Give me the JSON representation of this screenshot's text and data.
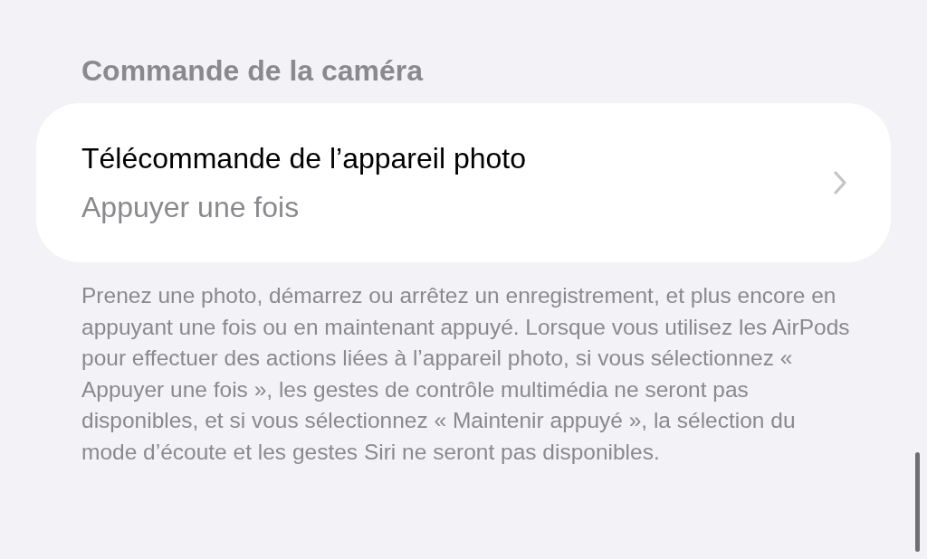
{
  "section": {
    "header": "Commande de la caméra",
    "row": {
      "title": "Télécommande de l’appareil photo",
      "value": "Appuyer une fois"
    },
    "footer": "Prenez une photo, démarrez ou arrêtez un enregistrement, et plus encore en appuyant une fois ou en maintenant appuyé. Lorsque vous utilisez les AirPods pour effectuer des actions liées à l’appareil photo, si vous sélectionnez « Appuyer une fois », les gestes de contrôle multimédia ne seront pas disponibles, et si vous sélectionnez « Maintenir appuyé », la sélection du mode d’écoute et les gestes Siri ne seront pas disponibles."
  }
}
